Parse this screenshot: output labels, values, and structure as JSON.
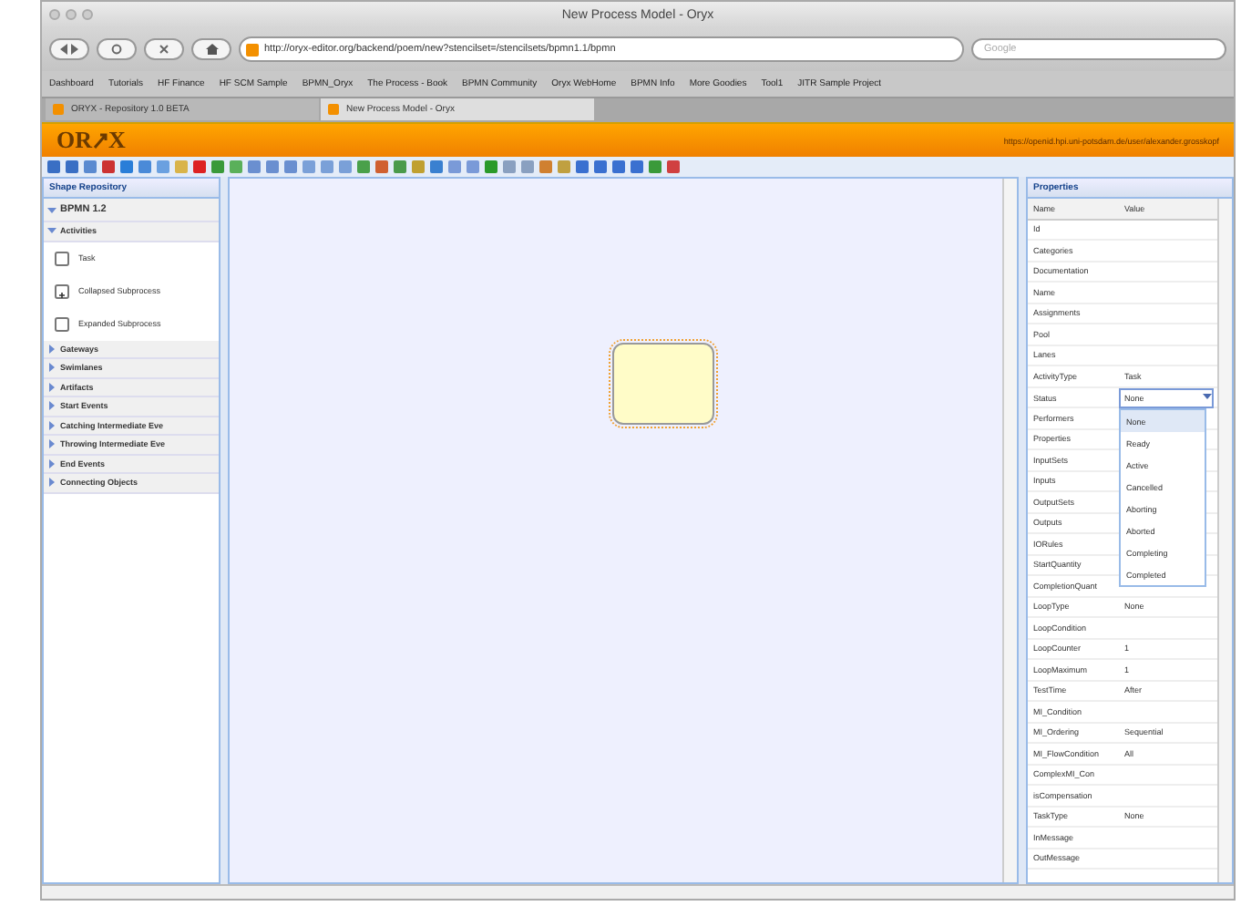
{
  "window": {
    "title": "New Process Model - Oryx"
  },
  "address_bar": {
    "url": "http://oryx-editor.org/backend/poem/new?stencilset=/stencilsets/bpmn1.1/bpmn"
  },
  "search": {
    "placeholder": "Google"
  },
  "bookmarks": [
    "Dashboard",
    "Tutorials",
    "HF Finance",
    "HF SCM Sample",
    "BPMN_Oryx",
    "The Process - Book",
    "BPMN Community",
    "Oryx WebHome",
    "BPMN Info",
    "More Goodies",
    "Tool1",
    "JITR Sample Project"
  ],
  "tabs": [
    {
      "label": "ORYX - Repository 1.0 BETA",
      "selected": false
    },
    {
      "label": "New Process Model - Oryx",
      "selected": true
    }
  ],
  "header": {
    "logo_left": "OR",
    "logo_right": "X",
    "user_link": "https://openid.hpi.uni-potsdam.de/user/alexander.grosskopf"
  },
  "shape_repository": {
    "title": "Shape Repository",
    "stencil_set": "BPMN 1.2",
    "categories": [
      {
        "label": "Activities",
        "expanded": true,
        "shapes": [
          {
            "label": "Task",
            "kind": "task"
          },
          {
            "label": "Collapsed Subprocess",
            "kind": "collapsed"
          },
          {
            "label": "Expanded Subprocess",
            "kind": "task"
          }
        ]
      },
      {
        "label": "Gateways",
        "expanded": false
      },
      {
        "label": "Swimlanes",
        "expanded": false
      },
      {
        "label": "Artifacts",
        "expanded": false
      },
      {
        "label": "Start Events",
        "expanded": false
      },
      {
        "label": "Catching Intermediate Eve",
        "expanded": false
      },
      {
        "label": "Throwing Intermediate Eve",
        "expanded": false
      },
      {
        "label": "End Events",
        "expanded": false
      },
      {
        "label": "Connecting Objects",
        "expanded": false
      }
    ]
  },
  "canvas": {
    "shapes": [
      {
        "kind": "task",
        "selected": true
      }
    ]
  },
  "properties": {
    "title": "Properties",
    "columns": [
      "Name",
      "Value"
    ],
    "rows": [
      {
        "name": "Id"
      },
      {
        "name": "Categories"
      },
      {
        "name": "Documentation"
      },
      {
        "name": "Name"
      },
      {
        "name": "Assignments"
      },
      {
        "name": "Pool"
      },
      {
        "name": "Lanes"
      },
      {
        "name": "ActivityType",
        "value": "Task"
      },
      {
        "name": "Status",
        "value": "None",
        "kind": "dropdown"
      },
      {
        "name": "Performers"
      },
      {
        "name": "Properties"
      },
      {
        "name": "InputSets"
      },
      {
        "name": "Inputs"
      },
      {
        "name": "OutputSets"
      },
      {
        "name": "Outputs"
      },
      {
        "name": "IORules"
      },
      {
        "name": "StartQuantity"
      },
      {
        "name": "CompletionQuant"
      },
      {
        "name": "LoopType",
        "value": "None"
      },
      {
        "name": "LoopCondition"
      },
      {
        "name": "LoopCounter",
        "value": "1"
      },
      {
        "name": "LoopMaximum",
        "value": "1"
      },
      {
        "name": "TestTime",
        "value": "After"
      },
      {
        "name": "MI_Condition"
      },
      {
        "name": "MI_Ordering",
        "value": "Sequential"
      },
      {
        "name": "MI_FlowCondition",
        "value": "All"
      },
      {
        "name": "ComplexMI_Con"
      },
      {
        "name": "isCompensation"
      },
      {
        "name": "TaskType",
        "value": "None"
      },
      {
        "name": "InMessage"
      },
      {
        "name": "OutMessage"
      }
    ],
    "status_options": [
      {
        "label": "None",
        "selected": true
      },
      {
        "label": "Ready",
        "selected": false
      },
      {
        "label": "Active",
        "selected": false
      },
      {
        "label": "Cancelled",
        "selected": false
      },
      {
        "label": "Aborting",
        "selected": false
      },
      {
        "label": "Aborted",
        "selected": false
      },
      {
        "label": "Completing",
        "selected": false
      },
      {
        "label": "Completed",
        "selected": false
      }
    ]
  }
}
